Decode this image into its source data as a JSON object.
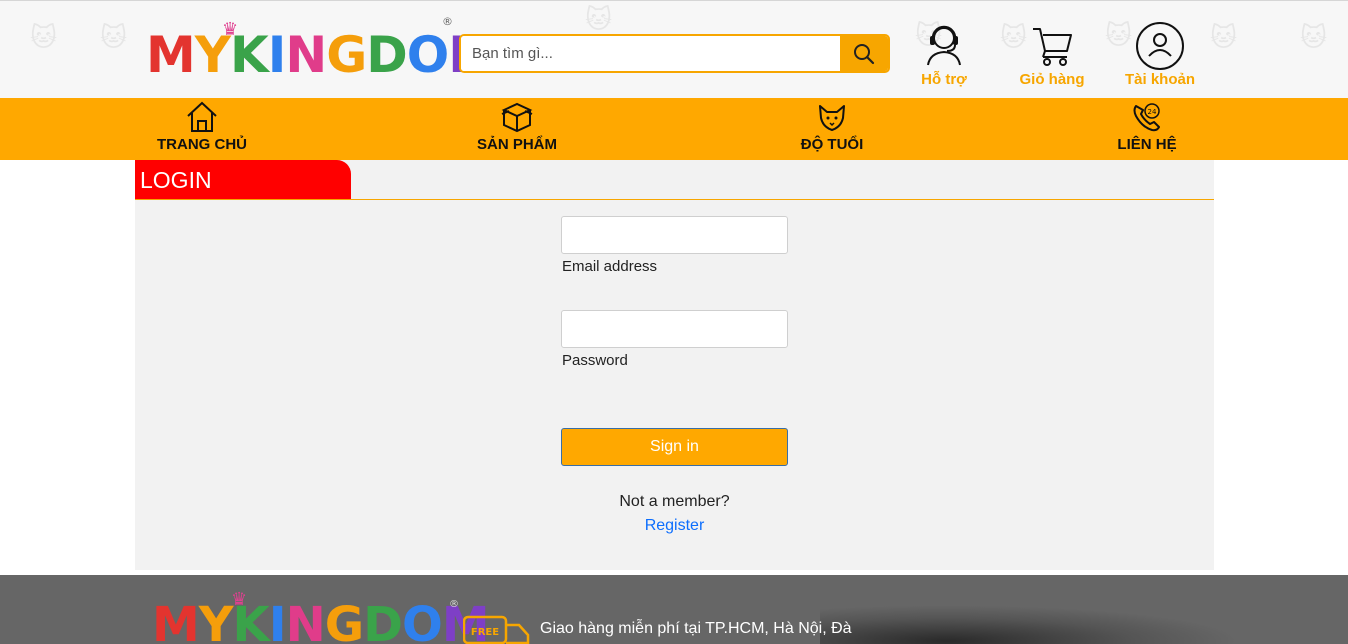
{
  "brand": {
    "logo_text": "MYKINGDOM",
    "registered": "®"
  },
  "search": {
    "placeholder": "Bạn tìm gì..."
  },
  "header_actions": {
    "support": "Hỗ trợ",
    "cart": "Giỏ hàng",
    "account": "Tài khoản"
  },
  "nav": {
    "home": "TRANG CHỦ",
    "products": "SẢN PHẨM",
    "age": "ĐỘ TUỔI",
    "contact": "LIÊN HỆ"
  },
  "login": {
    "tab_title": "LOGIN",
    "email_label": "Email address",
    "email_value": "",
    "password_label": "Password",
    "password_value": "",
    "signin_label": "Sign in",
    "not_member": "Not a member?",
    "register_label": "Register"
  },
  "footer": {
    "free_badge": "FREE",
    "shipping_text": "Giao hàng miễn phí tại TP.HCM, Hà Nội, Đà"
  },
  "colors": {
    "accent": "#ffa800",
    "login_tab": "#ff0000",
    "link": "#0d6efd",
    "footer_bg": "#666666"
  },
  "icons": [
    "search-icon",
    "support-headset-icon",
    "cart-icon",
    "account-icon",
    "home-icon",
    "box-icon",
    "fox-face-icon",
    "phone-24-icon",
    "truck-icon"
  ]
}
